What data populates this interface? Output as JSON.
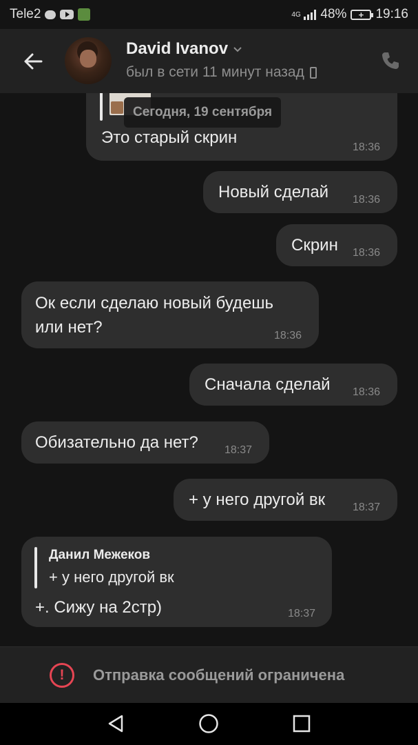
{
  "status_bar": {
    "carrier": "Tele2",
    "network": "4G",
    "battery_percent": "48%",
    "time": "19:16",
    "icons": [
      "chat-bubble-icon",
      "youtube-icon",
      "app-icon",
      "signal-icon",
      "battery-charging-icon"
    ]
  },
  "header": {
    "contact_name": "David Ivanov",
    "last_seen": "был в сети 11 минут назад",
    "icons": [
      "back-arrow-icon",
      "chevron-down-icon",
      "mobile-phone-icon",
      "call-icon"
    ]
  },
  "chat": {
    "date_badge": "Сегодня, 19 сентября",
    "messages": [
      {
        "side": "in",
        "text": "Это старый скрин",
        "time": "18:36"
      },
      {
        "side": "out",
        "text": "Новый сделай",
        "time": "18:36"
      },
      {
        "side": "out",
        "text": "Скрин",
        "time": "18:36"
      },
      {
        "side": "in",
        "text_line1": "Ок если сделаю новый будешь",
        "text_line2": "или нет?",
        "time": "18:36"
      },
      {
        "side": "out",
        "text": "Сначала сделай",
        "time": "18:36"
      },
      {
        "side": "in",
        "text": "Обизательно да нет?",
        "time": "18:37"
      },
      {
        "side": "out",
        "text": "+ у него другой вк",
        "time": "18:37"
      },
      {
        "side": "in",
        "reply_author": "Данил Межеков",
        "reply_text": "+ у него другой вк",
        "text": "+. Сижу на 2стр)",
        "time": "18:37"
      }
    ]
  },
  "restriction": {
    "text": "Отправка сообщений ограничена",
    "icon": "alert-icon",
    "color": "#e64553"
  },
  "nav_bar": {
    "icons": [
      "nav-back-icon",
      "nav-home-icon",
      "nav-recents-icon"
    ]
  },
  "colors": {
    "background": "#141414",
    "header": "#222222",
    "bubble": "#2e2e2e"
  }
}
